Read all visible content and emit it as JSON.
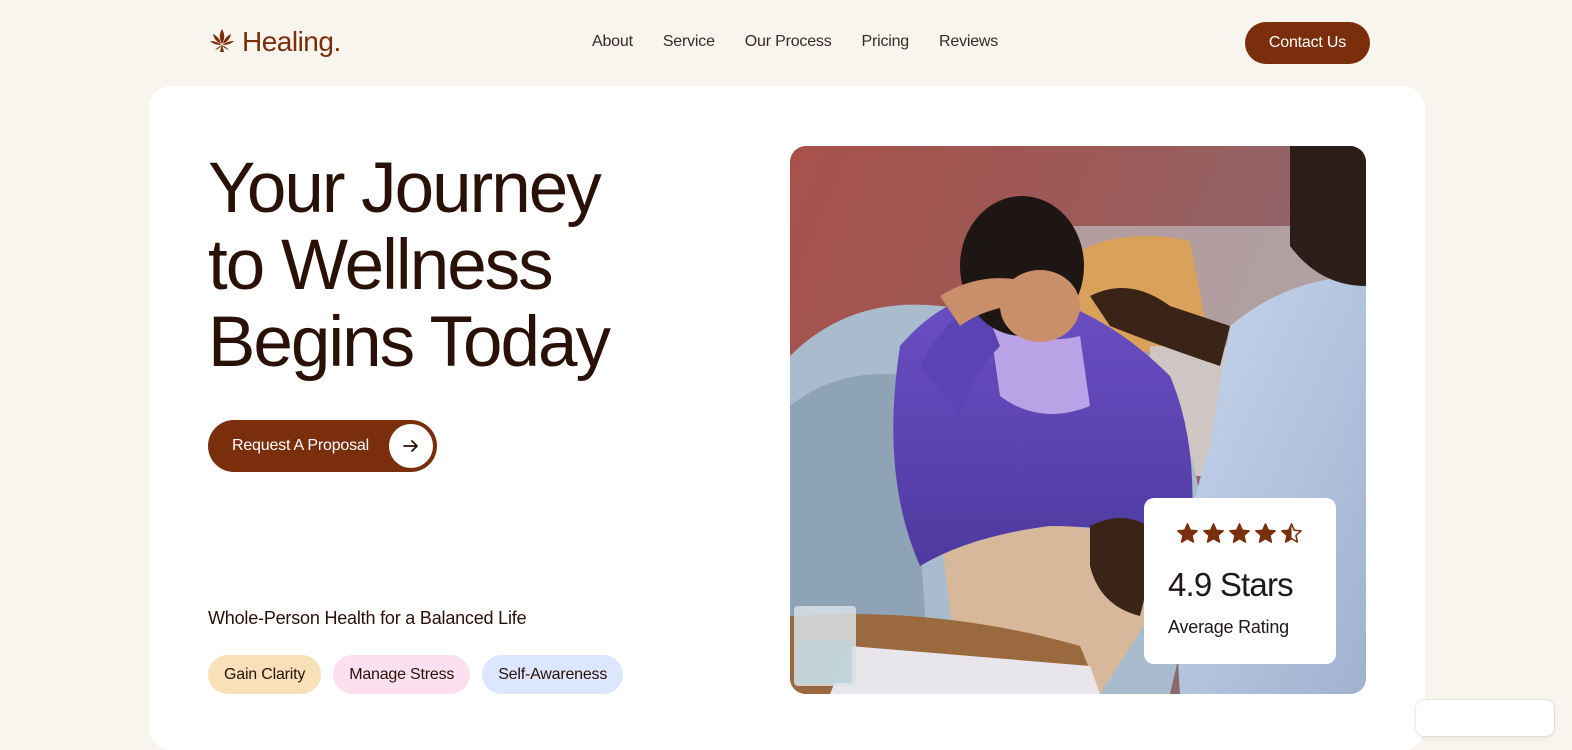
{
  "brand": {
    "name": "Healing.",
    "icon": "lotus-icon",
    "color": "#7a2e0c"
  },
  "nav": {
    "items": [
      "About",
      "Service",
      "Our Process",
      "Pricing",
      "Reviews"
    ]
  },
  "header": {
    "contact_label": "Contact Us"
  },
  "hero": {
    "title_lines": [
      "Your Journey",
      "to Wellness",
      "Begins Today"
    ],
    "cta_label": "Request A Proposal",
    "cta_icon": "arrow-right-icon",
    "tagline": "Whole-Person Health for a Balanced Life",
    "chips": [
      {
        "label": "Gain Clarity",
        "color": "#f8e1b8"
      },
      {
        "label": "Manage Stress",
        "color": "#fce0ef"
      },
      {
        "label": "Self-Awareness",
        "color": "#dce6ff"
      }
    ]
  },
  "rating": {
    "stars": 4.5,
    "star_color": "#7a2e0c",
    "value": "4.9 Stars",
    "label": "Average Rating"
  },
  "colors": {
    "page_bg": "#f8f4ee",
    "accent": "#7a2e0c",
    "text": "#2a1108"
  }
}
